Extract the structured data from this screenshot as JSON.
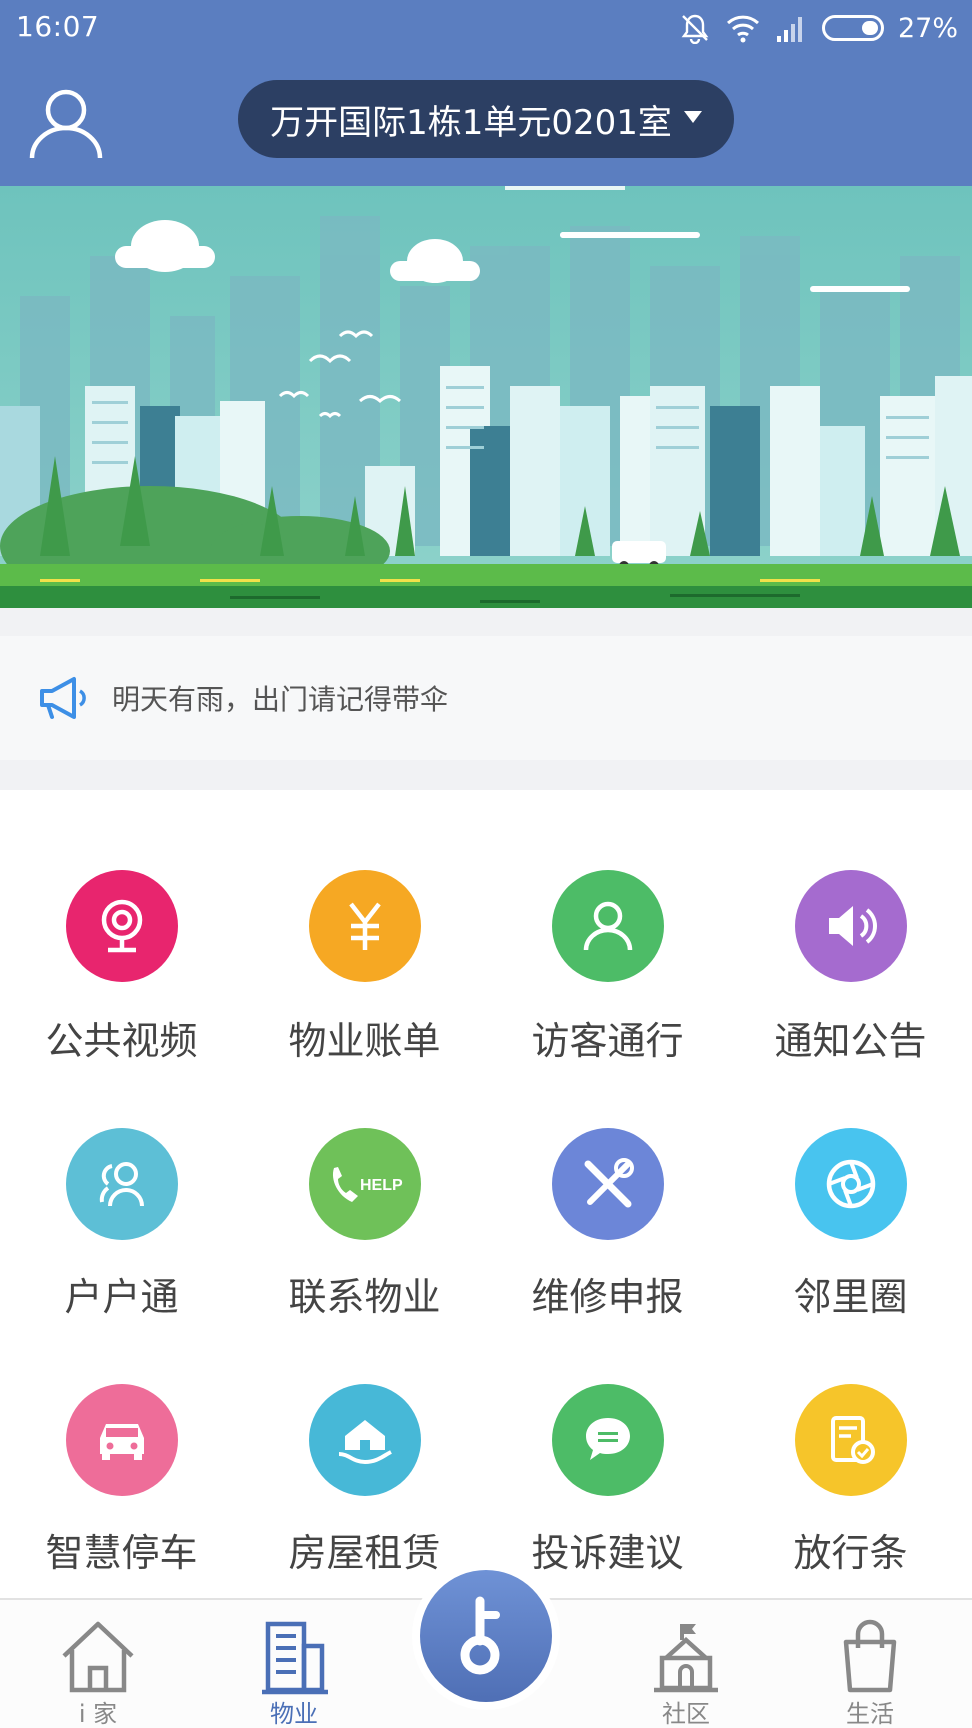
{
  "status_bar": {
    "time": "16:07",
    "battery": "27%"
  },
  "header": {
    "address": "万开国际1栋1单元0201室"
  },
  "notice": {
    "text": "明天有雨，出门请记得带伞"
  },
  "grid": {
    "items": [
      {
        "label": "公共视频",
        "icon": "camera-icon",
        "color": "#e8256e"
      },
      {
        "label": "物业账单",
        "icon": "yen-icon",
        "color": "#f6a823"
      },
      {
        "label": "访客通行",
        "icon": "person-icon",
        "color": "#4dbc67"
      },
      {
        "label": "通知公告",
        "icon": "speaker-icon",
        "color": "#a56bcf"
      },
      {
        "label": "户户通",
        "icon": "people-icon",
        "color": "#5dbfd6"
      },
      {
        "label": "联系物业",
        "icon": "help-phone-icon",
        "color": "#6fc159"
      },
      {
        "label": "维修申报",
        "icon": "tools-icon",
        "color": "#6c86d8"
      },
      {
        "label": "邻里圈",
        "icon": "shutter-icon",
        "color": "#48c4ef"
      },
      {
        "label": "智慧停车",
        "icon": "car-icon",
        "color": "#ee6d99"
      },
      {
        "label": "房屋租赁",
        "icon": "house-hand-icon",
        "color": "#47b8d7"
      },
      {
        "label": "投诉建议",
        "icon": "chat-icon",
        "color": "#4dbc67"
      },
      {
        "label": "放行条",
        "icon": "pass-icon",
        "color": "#f6c52a"
      }
    ]
  },
  "nav": {
    "items": [
      {
        "label": "i 家",
        "icon": "home-icon"
      },
      {
        "label": "物业",
        "icon": "building-icon"
      },
      {
        "label": "社区",
        "icon": "community-icon"
      },
      {
        "label": "生活",
        "icon": "bag-icon"
      }
    ],
    "active": "物业",
    "center_icon": "key-icon"
  }
}
